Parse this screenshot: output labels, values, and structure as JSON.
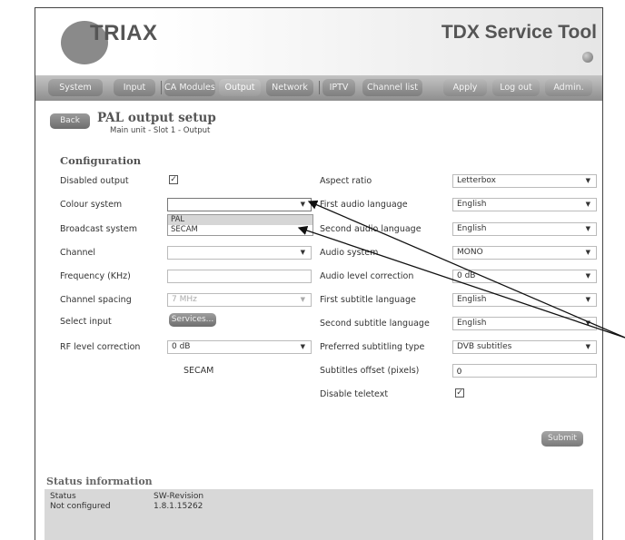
{
  "header": {
    "logo_text": "TRIAX",
    "app_title": "TDX Service Tool"
  },
  "nav": {
    "tabs": [
      {
        "label": "System"
      },
      {
        "label": "Input"
      },
      {
        "label": "CA Modules"
      },
      {
        "label": "Output",
        "active": true
      },
      {
        "label": "Network"
      },
      {
        "label": "IPTV"
      },
      {
        "label": "Channel list"
      }
    ],
    "actions": [
      {
        "label": "Apply"
      },
      {
        "label": "Log out"
      },
      {
        "label": "Admin."
      }
    ]
  },
  "page": {
    "back_label": "Back",
    "title": "PAL output setup",
    "breadcrumb": "Main unit - Slot 1 - Output"
  },
  "config": {
    "section_title": "Configuration",
    "left": {
      "disabled_output": {
        "label": "Disabled output",
        "checked": true
      },
      "colour_system": {
        "label": "Colour system",
        "value": ""
      },
      "colour_system_options": [
        "PAL",
        "SECAM"
      ],
      "broadcast_system": {
        "label": "Broadcast system"
      },
      "channel": {
        "label": "Channel",
        "value": ""
      },
      "frequency": {
        "label": "Frequency (KHz)",
        "value": ""
      },
      "channel_spacing": {
        "label": "Channel spacing",
        "value": "7 MHz"
      },
      "select_input": {
        "label": "Select input",
        "button": "Services..."
      },
      "rf_level": {
        "label": "RF level correction",
        "value": "0 dB"
      },
      "note": "SECAM"
    },
    "right": {
      "aspect_ratio": {
        "label": "Aspect ratio",
        "value": "Letterbox"
      },
      "first_audio": {
        "label": "First audio language",
        "value": "English"
      },
      "second_audio": {
        "label": "Second audio language",
        "value": "English"
      },
      "audio_system": {
        "label": "Audio system",
        "value": "MONO"
      },
      "audio_level": {
        "label": "Audio level correction",
        "value": "0 dB"
      },
      "first_subtitle": {
        "label": "First subtitle language",
        "value": "English"
      },
      "second_subtitle": {
        "label": "Second subtitle language",
        "value": "English"
      },
      "subtitling_type": {
        "label": "Preferred subtitling type",
        "value": "DVB subtitles"
      },
      "subtitles_offset": {
        "label": "Subtitles offset (pixels)",
        "value": "0"
      },
      "disable_teletext": {
        "label": "Disable teletext",
        "checked": true
      }
    },
    "submit_label": "Submit"
  },
  "status": {
    "title": "Status information",
    "status_label": "Status",
    "status_value": "Not configured",
    "sw_label": "SW-Revision",
    "sw_value": "1.8.1.15262"
  },
  "colors": {
    "nav_bg": "#9a9a9a",
    "panel_bg": "#d8d8d8",
    "accent": "#555555"
  }
}
